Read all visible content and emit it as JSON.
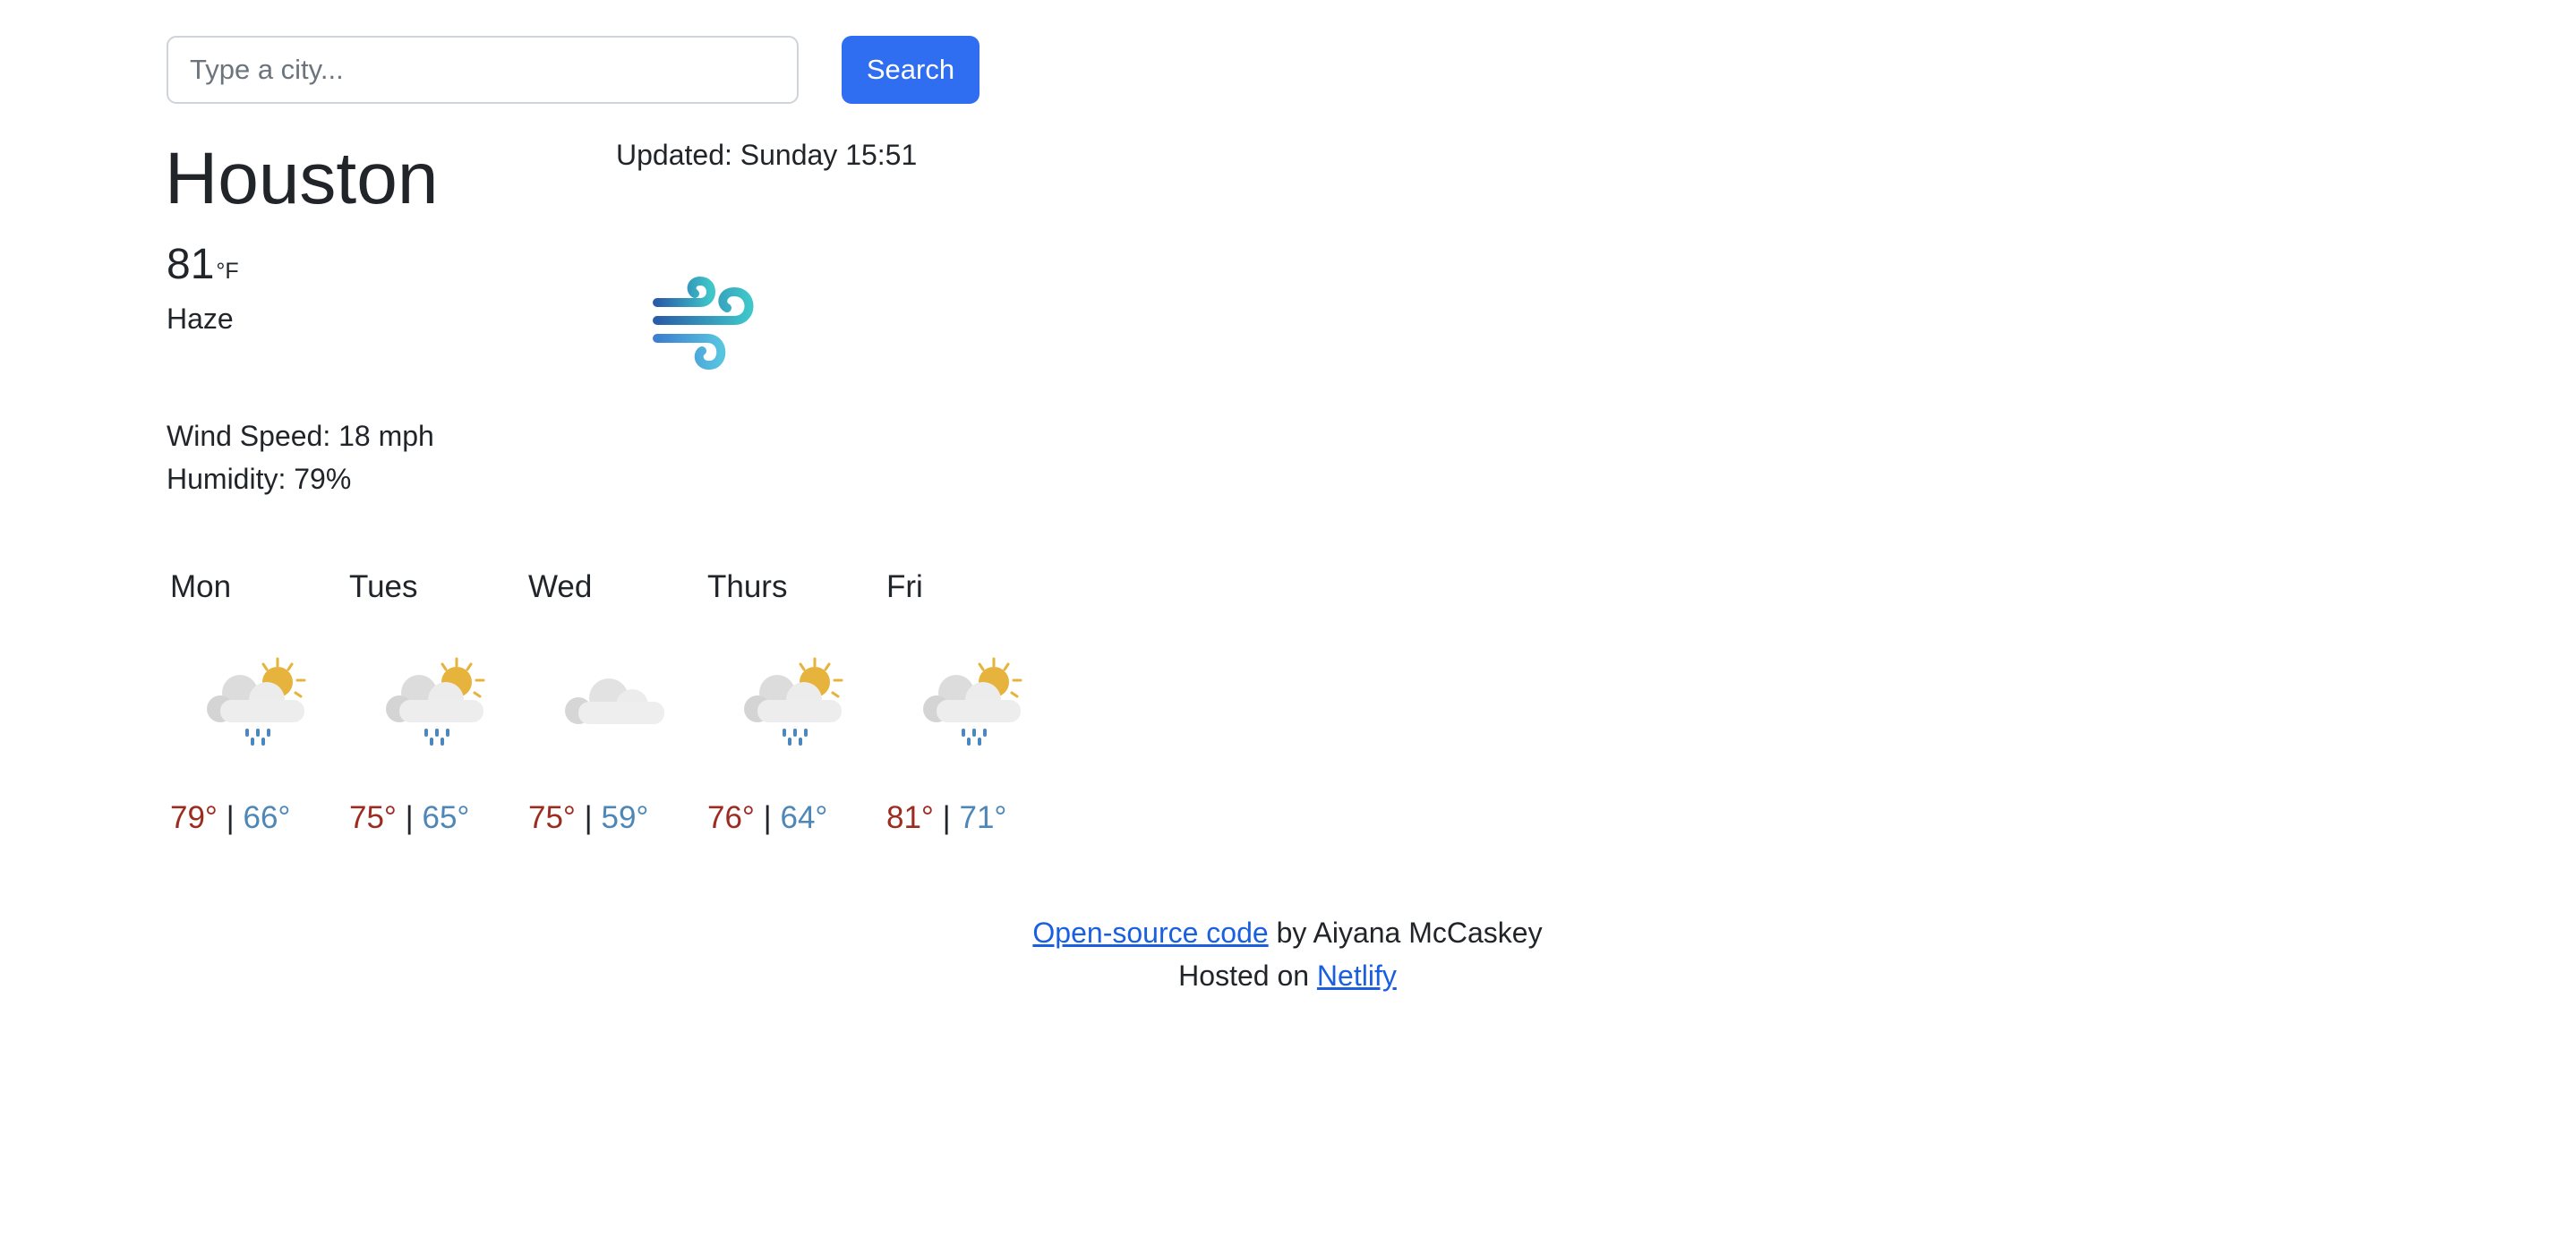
{
  "search": {
    "placeholder": "Type a city...",
    "value": "",
    "button_label": "Search"
  },
  "current": {
    "city": "Houston",
    "updated": "Updated: Sunday 15:51",
    "temperature": "81",
    "unit": "°F",
    "description": "Haze",
    "icon": "wind-icon",
    "wind": "Wind Speed: 18 mph",
    "humidity": "Humidity: 79%"
  },
  "forecast": [
    {
      "day": "Mon",
      "icon": "rain-sun-cloud-icon",
      "high": "79°",
      "low": "66°"
    },
    {
      "day": "Tues",
      "icon": "rain-sun-cloud-icon",
      "high": "75°",
      "low": "65°"
    },
    {
      "day": "Wed",
      "icon": "cloud-icon",
      "high": "75°",
      "low": "59°"
    },
    {
      "day": "Thurs",
      "icon": "rain-sun-cloud-icon",
      "high": "76°",
      "low": "64°"
    },
    {
      "day": "Fri",
      "icon": "rain-sun-cloud-icon",
      "high": "81°",
      "low": "71°"
    }
  ],
  "temp_separator": "|",
  "footer": {
    "code_link": "Open-source code",
    "author_text": " by Aiyana McCaskey",
    "hosted_text": "Hosted on ",
    "host_link": "Netlify"
  },
  "colors": {
    "accent": "#2f6ef0",
    "high_temp": "#9b2c1f",
    "low_temp": "#4d87b8",
    "link": "#1a5fe0"
  }
}
